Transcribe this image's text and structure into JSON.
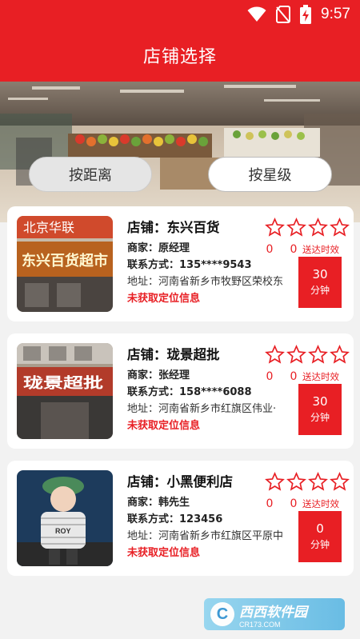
{
  "status_bar": {
    "time": "9:57",
    "icons": [
      "wifi-icon",
      "no-sim-icon",
      "battery-charging-icon"
    ]
  },
  "header": {
    "title": "店铺选择"
  },
  "sort_buttons": {
    "by_distance": "按距离",
    "by_rating": "按星级"
  },
  "stores": [
    {
      "name": "店铺：东兴百货",
      "merchant": "商家：原经理",
      "contact": "联系方式：135****9543",
      "address": "地址：河南省新乡市牧野区荣校东",
      "location_status": "未获取定位信息",
      "rating_stars": 0,
      "count_left": "0",
      "count_right": "0",
      "eta_label": "送达时效",
      "eta_value": "30",
      "eta_unit": "分钟",
      "thumb_sign": "东兴百货超市",
      "thumb_sign_small": "北京华联"
    },
    {
      "name": "店铺：珑景超批",
      "merchant": "商家：张经理",
      "contact": "联系方式：158****6088",
      "address": "地址：河南省新乡市红旗区伟业·",
      "location_status": "未获取定位信息",
      "rating_stars": 0,
      "count_left": "0",
      "count_right": "0",
      "eta_label": "送达时效",
      "eta_value": "30",
      "eta_unit": "分钟",
      "thumb_sign": "珑景超批"
    },
    {
      "name": "店铺：小黑便利店",
      "merchant": "商家：韩先生",
      "contact": "联系方式：123456",
      "address": "地址：河南省新乡市红旗区平原中",
      "location_status": "未获取定位信息",
      "rating_stars": 0,
      "count_left": "0",
      "count_right": "0",
      "eta_label": "送达时效",
      "eta_value": "0",
      "eta_unit": "分钟",
      "thumb_sign": "ROY"
    }
  ],
  "watermark": {
    "logo": "C",
    "text": "西西软件园",
    "sub": "CR173.COM"
  },
  "colors": {
    "brand_red": "#e81f24",
    "background": "#f2f2f2",
    "card": "#ffffff"
  }
}
